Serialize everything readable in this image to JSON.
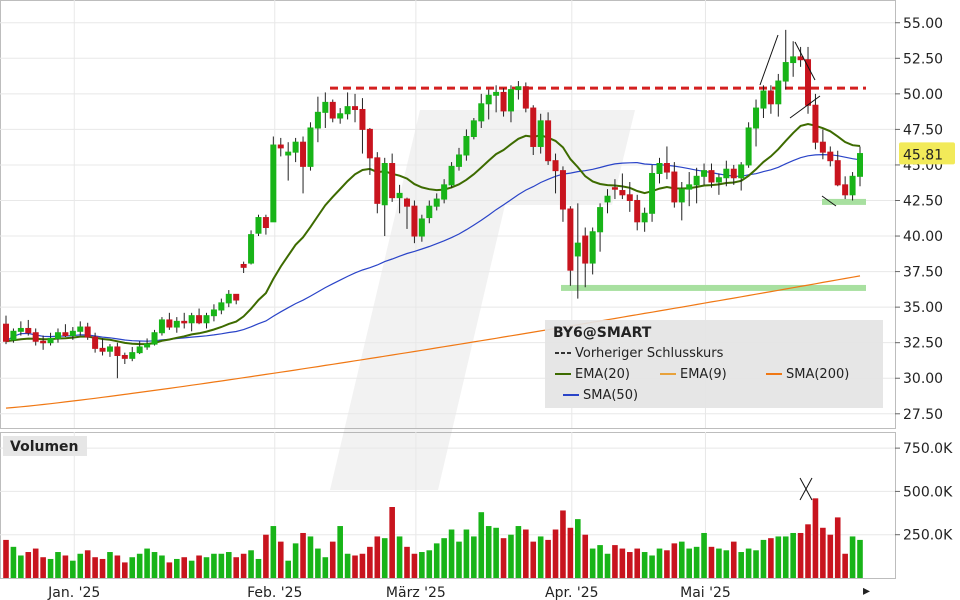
{
  "chart_data": {
    "type": "candlestick",
    "symbol": "BY6@SMART",
    "price_axis": {
      "ticks": [
        "55.00",
        "52.50",
        "50.00",
        "47.50",
        "45.00",
        "42.50",
        "40.00",
        "37.50",
        "35.00",
        "32.50",
        "30.00",
        "27.50"
      ],
      "ylim": [
        26.5,
        56.6
      ]
    },
    "volume_axis": {
      "label": "Volumen",
      "ticks": [
        "750.0K",
        "500.0K",
        "250.0K"
      ],
      "ylim": [
        0,
        820000
      ]
    },
    "x_tick_labels": [
      "Jan. '25",
      "Feb. '25",
      "März '25",
      "Apr. '25",
      "Mai '25"
    ],
    "x_tick_index": [
      10,
      37,
      56,
      77,
      95
    ],
    "last_price": "45.81",
    "previous_close": 50.4,
    "legend": {
      "title": "BY6@SMART",
      "items": [
        {
          "label": "Vorheriger Schlusskurs",
          "color": "#cc0000",
          "style": "dashed"
        },
        {
          "label": "EMA(20)",
          "color": "#3d6b00"
        },
        {
          "label": "EMA(9)",
          "color": "#e8a23b"
        },
        {
          "label": "SMA(200)",
          "color": "#f07814"
        },
        {
          "label": "SMA(50)",
          "color": "#2a44c8"
        }
      ]
    },
    "colors": {
      "up": "#18b418",
      "down": "#c8141e",
      "ema20": "#3d6b00",
      "sma50": "#2a44c8",
      "sma200": "#f07814",
      "prev_close": "#d42020",
      "support": "#a8e0a0"
    },
    "candles": [
      [
        33.8,
        34.4,
        32.4,
        32.6
      ],
      [
        32.7,
        33.5,
        32.5,
        33.3
      ],
      [
        33.3,
        34.0,
        33.0,
        33.5
      ],
      [
        33.5,
        34.1,
        33.0,
        33.2
      ],
      [
        33.2,
        33.5,
        32.3,
        32.6
      ],
      [
        32.6,
        33.0,
        32.0,
        32.5
      ],
      [
        32.5,
        33.2,
        32.3,
        32.8
      ],
      [
        32.8,
        33.5,
        32.5,
        33.2
      ],
      [
        33.2,
        33.8,
        32.9,
        33.0
      ],
      [
        33.0,
        33.6,
        32.7,
        33.3
      ],
      [
        33.3,
        34.0,
        33.0,
        33.6
      ],
      [
        33.6,
        33.9,
        32.7,
        32.9
      ],
      [
        32.9,
        33.2,
        31.8,
        32.1
      ],
      [
        32.1,
        32.8,
        31.6,
        31.9
      ],
      [
        31.9,
        32.4,
        31.5,
        32.2
      ],
      [
        32.2,
        32.5,
        30.0,
        31.6
      ],
      [
        31.6,
        31.8,
        31.0,
        31.4
      ],
      [
        31.4,
        32.2,
        31.2,
        31.8
      ],
      [
        31.8,
        32.6,
        31.7,
        32.2
      ],
      [
        32.2,
        32.8,
        32.0,
        32.4
      ],
      [
        32.4,
        33.4,
        32.3,
        33.2
      ],
      [
        33.2,
        34.3,
        33.0,
        34.1
      ],
      [
        34.1,
        34.6,
        33.4,
        33.6
      ],
      [
        33.6,
        34.3,
        33.2,
        34.0
      ],
      [
        34.0,
        34.6,
        33.5,
        33.9
      ],
      [
        33.9,
        34.6,
        33.3,
        34.4
      ],
      [
        34.4,
        34.9,
        33.8,
        33.9
      ],
      [
        33.9,
        34.6,
        33.5,
        34.4
      ],
      [
        34.4,
        35.2,
        34.0,
        34.8
      ],
      [
        34.8,
        35.6,
        34.5,
        35.3
      ],
      [
        35.3,
        36.2,
        35.0,
        35.9
      ],
      [
        35.9,
        35.8,
        35.2,
        35.5
      ],
      [
        38.0,
        38.2,
        37.4,
        37.8
      ],
      [
        38.1,
        40.4,
        38.0,
        40.1
      ],
      [
        40.2,
        41.5,
        40.0,
        41.3
      ],
      [
        41.3,
        41.5,
        40.1,
        40.6
      ],
      [
        41.0,
        47.0,
        41.0,
        46.4
      ],
      [
        46.4,
        46.9,
        45.6,
        46.2
      ],
      [
        45.7,
        46.6,
        43.9,
        45.9
      ],
      [
        45.9,
        46.9,
        45.2,
        46.6
      ],
      [
        46.6,
        47.0,
        43.0,
        44.9
      ],
      [
        44.9,
        48.0,
        44.6,
        47.6
      ],
      [
        47.6,
        49.8,
        46.6,
        48.7
      ],
      [
        48.7,
        50.1,
        47.6,
        49.4
      ],
      [
        49.4,
        49.6,
        48.0,
        48.3
      ],
      [
        48.3,
        49.0,
        47.9,
        48.6
      ],
      [
        48.6,
        50.1,
        48.2,
        49.1
      ],
      [
        49.1,
        50.0,
        48.0,
        48.9
      ],
      [
        48.9,
        49.7,
        45.8,
        47.5
      ],
      [
        47.5,
        47.6,
        44.3,
        45.5
      ],
      [
        45.5,
        45.9,
        41.6,
        42.3
      ],
      [
        42.2,
        45.5,
        40.0,
        45.1
      ],
      [
        45.1,
        45.8,
        42.4,
        42.7
      ],
      [
        42.7,
        43.6,
        41.6,
        43.0
      ],
      [
        42.6,
        42.7,
        40.5,
        42.1
      ],
      [
        42.1,
        42.5,
        39.5,
        40.0
      ],
      [
        40.0,
        41.5,
        39.6,
        41.2
      ],
      [
        41.3,
        42.5,
        40.9,
        42.1
      ],
      [
        42.1,
        43.0,
        41.8,
        42.6
      ],
      [
        42.6,
        44.0,
        42.3,
        43.6
      ],
      [
        43.6,
        45.2,
        43.4,
        44.9
      ],
      [
        44.9,
        46.2,
        44.6,
        45.7
      ],
      [
        45.7,
        47.5,
        45.3,
        47.0
      ],
      [
        47.0,
        48.3,
        46.8,
        48.1
      ],
      [
        48.1,
        50.0,
        47.6,
        49.3
      ],
      [
        49.3,
        50.3,
        48.2,
        49.9
      ],
      [
        49.9,
        50.6,
        48.7,
        50.1
      ],
      [
        50.1,
        50.4,
        48.4,
        48.8
      ],
      [
        48.8,
        50.6,
        48.0,
        50.3
      ],
      [
        50.3,
        50.9,
        49.6,
        50.5
      ],
      [
        50.5,
        50.8,
        48.7,
        49.0
      ],
      [
        49.0,
        49.2,
        45.7,
        46.3
      ],
      [
        46.3,
        48.6,
        45.8,
        48.1
      ],
      [
        48.1,
        48.7,
        45.0,
        45.3
      ],
      [
        45.3,
        45.8,
        43.0,
        44.6
      ],
      [
        44.6,
        44.9,
        41.0,
        41.9
      ],
      [
        41.9,
        42.1,
        36.5,
        37.6
      ],
      [
        38.6,
        42.3,
        35.6,
        39.5
      ],
      [
        40.0,
        40.6,
        36.4,
        38.1
      ],
      [
        38.1,
        40.6,
        37.3,
        40.3
      ],
      [
        40.3,
        42.3,
        38.9,
        42.0
      ],
      [
        42.4,
        43.3,
        41.6,
        42.8
      ],
      [
        43.4,
        44.0,
        42.6,
        43.3
      ],
      [
        43.2,
        44.4,
        42.6,
        42.9
      ],
      [
        42.9,
        43.8,
        41.7,
        42.5
      ],
      [
        42.5,
        42.9,
        40.4,
        41.0
      ],
      [
        41.0,
        42.0,
        40.3,
        41.6
      ],
      [
        41.6,
        45.0,
        41.0,
        44.4
      ],
      [
        44.4,
        45.5,
        43.7,
        45.1
      ],
      [
        45.1,
        46.3,
        44.0,
        44.5
      ],
      [
        44.5,
        45.2,
        42.0,
        42.4
      ],
      [
        42.4,
        43.8,
        41.1,
        43.3
      ],
      [
        43.3,
        44.5,
        42.1,
        43.6
      ],
      [
        43.6,
        44.8,
        42.3,
        44.2
      ],
      [
        44.2,
        45.1,
        43.6,
        44.6
      ],
      [
        44.6,
        45.1,
        43.4,
        43.8
      ],
      [
        43.8,
        44.4,
        42.9,
        44.1
      ],
      [
        44.1,
        45.3,
        43.5,
        44.7
      ],
      [
        44.7,
        45.0,
        43.6,
        44.1
      ],
      [
        44.1,
        45.2,
        43.2,
        45.0
      ],
      [
        45.0,
        48.0,
        44.8,
        47.6
      ],
      [
        47.6,
        49.6,
        46.3,
        49.0
      ],
      [
        49.0,
        50.6,
        48.3,
        50.2
      ],
      [
        50.2,
        50.6,
        48.6,
        49.3
      ],
      [
        49.3,
        51.4,
        48.4,
        50.9
      ],
      [
        50.9,
        54.5,
        50.3,
        52.2
      ],
      [
        52.2,
        53.7,
        51.2,
        52.6
      ],
      [
        52.6,
        53.3,
        51.9,
        52.4
      ],
      [
        52.4,
        53.3,
        48.6,
        49.2
      ],
      [
        49.2,
        50.0,
        46.1,
        46.6
      ],
      [
        46.6,
        47.5,
        45.4,
        45.9
      ],
      [
        45.9,
        46.3,
        44.9,
        45.3
      ],
      [
        45.3,
        46.0,
        43.5,
        43.6
      ],
      [
        43.6,
        44.2,
        42.6,
        42.9
      ],
      [
        42.9,
        44.5,
        42.5,
        44.2
      ],
      [
        44.2,
        46.3,
        43.5,
        45.8
      ]
    ],
    "volume": [
      220,
      180,
      130,
      150,
      170,
      120,
      110,
      150,
      130,
      100,
      140,
      160,
      120,
      110,
      150,
      130,
      90,
      120,
      140,
      170,
      150,
      130,
      90,
      110,
      120,
      100,
      130,
      120,
      140,
      140,
      150,
      120,
      140,
      160,
      110,
      250,
      300,
      210,
      100,
      200,
      260,
      240,
      170,
      120,
      210,
      300,
      140,
      130,
      140,
      180,
      240,
      230,
      410,
      240,
      180,
      140,
      150,
      160,
      200,
      230,
      280,
      210,
      280,
      240,
      380,
      300,
      290,
      230,
      250,
      300,
      280,
      210,
      240,
      220,
      280,
      390,
      290,
      340,
      250,
      170,
      190,
      140,
      190,
      170,
      150,
      170,
      150,
      130,
      170,
      160,
      200,
      210,
      170,
      180,
      260,
      180,
      170,
      160,
      210,
      150,
      170,
      160,
      220,
      230,
      240,
      240,
      260,
      260,
      310,
      460,
      290,
      250,
      350,
      140,
      240,
      220
    ]
  },
  "volume_red_indices": [],
  "legend_title": "BY6@SMART",
  "volume_label": "Volumen"
}
